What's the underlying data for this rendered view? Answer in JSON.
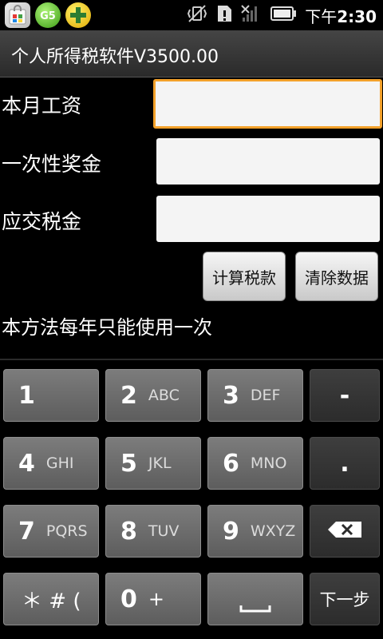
{
  "statusbar": {
    "notification_icons": [
      "market-bag-icon",
      "gs-icon",
      "plus-icon"
    ],
    "system_icons": [
      "vibrate-off-icon",
      "sd-card-warning-icon",
      "no-signal-icon",
      "battery-icon"
    ],
    "time_prefix": "下午",
    "time": "2:30"
  },
  "titlebar": {
    "title": "个人所得税软件V3500.00"
  },
  "form": {
    "salary_label": "本月工资",
    "salary_value": "",
    "bonus_label": "一次性奖金",
    "bonus_value": "",
    "tax_label": "应交税金",
    "tax_value": "",
    "calc_button": "计算税款",
    "clear_button": "清除数据",
    "note": "本方法每年只能使用一次"
  },
  "keyboard": {
    "row1": [
      {
        "num": "1",
        "sub": ""
      },
      {
        "num": "2",
        "sub": "ABC"
      },
      {
        "num": "3",
        "sub": "DEF"
      },
      {
        "sym": "-"
      }
    ],
    "row2": [
      {
        "num": "4",
        "sub": "GHI"
      },
      {
        "num": "5",
        "sub": "JKL"
      },
      {
        "num": "6",
        "sub": "MNO"
      },
      {
        "sym": "."
      }
    ],
    "row3": [
      {
        "num": "7",
        "sub": "PQRS"
      },
      {
        "num": "8",
        "sub": "TUV"
      },
      {
        "num": "9",
        "sub": "WXYZ"
      },
      {
        "icon": "backspace-icon"
      }
    ],
    "row4": [
      {
        "num": "＊ # (",
        "sub": ""
      },
      {
        "num": "0",
        "sub": "+"
      },
      {
        "icon": "space-icon"
      },
      {
        "label": "下一步"
      }
    ]
  },
  "colors": {
    "focus_border": "#f3a12a",
    "background": "#000000"
  }
}
